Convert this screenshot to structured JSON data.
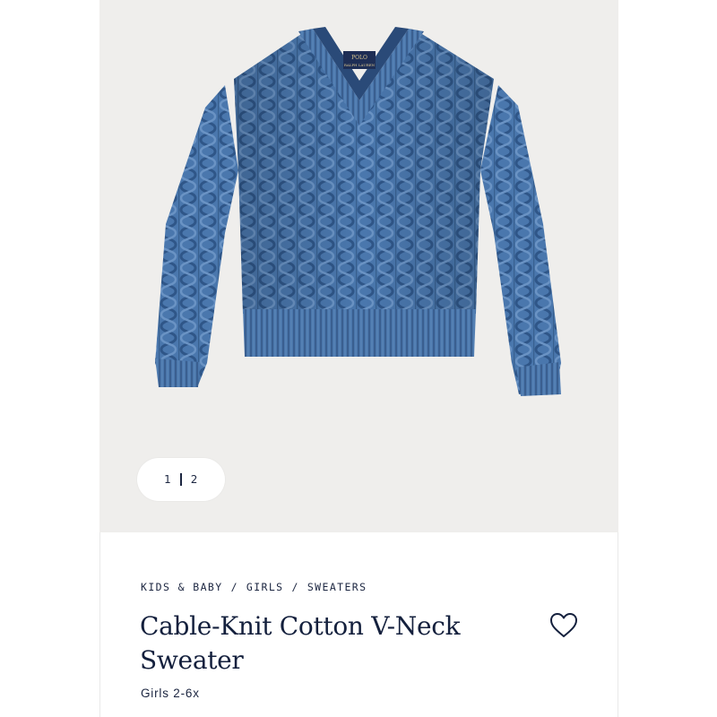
{
  "gallery": {
    "current_page": "1",
    "total_pages": "2",
    "label_logo_line1": "POLO",
    "label_logo_line2": "RALPH LAUREN",
    "background_color": "#efeeec",
    "sweater_color": "#4a77ad"
  },
  "breadcrumb": {
    "items": [
      "KIDS & BABY",
      "GIRLS",
      "SWEATERS"
    ],
    "separator": "/"
  },
  "product": {
    "title_line1": "Cable-Knit Cotton V-Neck",
    "title_line2": "Sweater",
    "subtitle": "Girls 2-6x"
  },
  "wishlist": {
    "icon": "heart-outline-icon"
  },
  "colors": {
    "text_primary": "#14203d"
  }
}
